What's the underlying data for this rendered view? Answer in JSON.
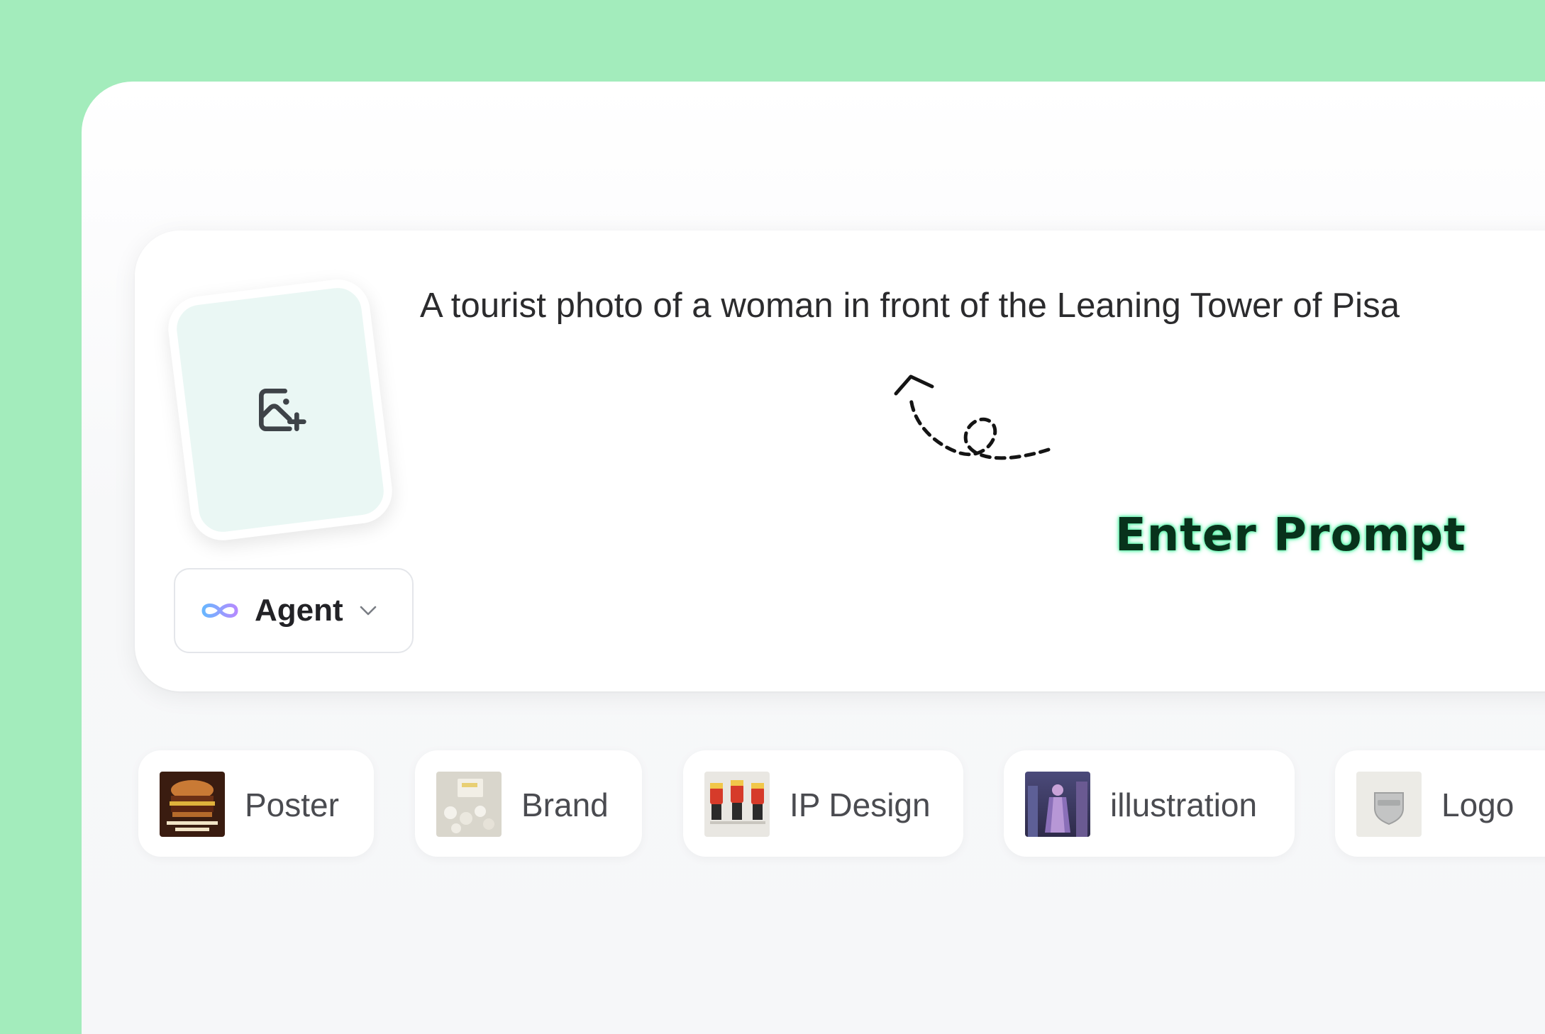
{
  "prompt": {
    "text": "A tourist photo of a woman in front of the Leaning Tower of Pisa",
    "upload_icon": "image-add-icon"
  },
  "hint": {
    "label": "Enter Prompt",
    "icon": "dashed-curved-arrow-icon",
    "glow_color": "#5cf2aa"
  },
  "agent_selector": {
    "label": "Agent",
    "icon": "infinity-icon",
    "caret_icon": "chevron-down-icon"
  },
  "categories": [
    {
      "label": "Poster",
      "thumb": "burger-poster-thumbnail"
    },
    {
      "label": "Brand",
      "thumb": "brand-mockup-thumbnail"
    },
    {
      "label": "IP Design",
      "thumb": "characters-thumbnail"
    },
    {
      "label": "illustration",
      "thumb": "illustration-thumbnail"
    },
    {
      "label": "Logo",
      "thumb": "logo-badge-thumbnail"
    }
  ],
  "colors": {
    "page_background": "#a3ecbc",
    "panel_background": "#f6f7f9",
    "upload_tile": "#eaf7f4",
    "infinity_gradient": [
      "#69b6ff",
      "#b48bff"
    ]
  }
}
